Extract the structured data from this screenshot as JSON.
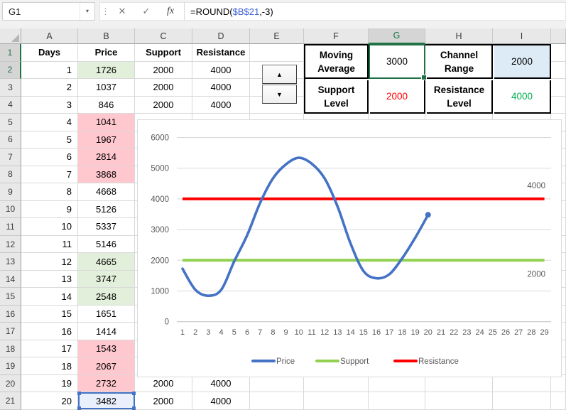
{
  "name_box": {
    "value": "G1"
  },
  "formula_bar": {
    "full": "=ROUND($B$21,-3)",
    "prefix": "=ROUND(",
    "reference": "$B$21",
    "suffix": ",-3)"
  },
  "icons": {
    "cancel": "✕",
    "enter": "✓",
    "function": "fx",
    "namebox_dropdown": "▾",
    "drag_handle": "⋮",
    "spin_up": "▲",
    "spin_down": "▼"
  },
  "colors": {
    "selection_green": "#1E7145",
    "reference_blue": "#4472C4",
    "fill_green": "#E2EFDA",
    "fill_pink": "#FFC7CE",
    "fill_blue": "#DDEBF7",
    "fill_ref": "#E9F0FB",
    "text_red": "#FF0000",
    "text_green": "#00B050"
  },
  "sheet": {
    "column_headers": [
      "A",
      "B",
      "C",
      "D",
      "E",
      "F",
      "G",
      "H",
      "I"
    ],
    "selected_column": "G",
    "selected_cell": "G1",
    "referenced_cell": "B21",
    "selected_row_headers": [
      1,
      2
    ],
    "rows": [
      {
        "r": 1,
        "bold": true,
        "cells": {
          "A": "Days",
          "B": "Price",
          "C": "Support",
          "D": "Resistance"
        }
      },
      {
        "r": 2,
        "cells": {
          "A": "1",
          "B": "1726",
          "C": "2000",
          "D": "4000"
        },
        "fills": {
          "B": "green"
        }
      },
      {
        "r": 3,
        "cells": {
          "A": "2",
          "B": "1037",
          "C": "2000",
          "D": "4000"
        }
      },
      {
        "r": 4,
        "cells": {
          "A": "3",
          "B": "846",
          "C": "2000",
          "D": "4000"
        }
      },
      {
        "r": 5,
        "cells": {
          "A": "4",
          "B": "1041"
        },
        "fills": {
          "B": "pink"
        }
      },
      {
        "r": 6,
        "cells": {
          "A": "5",
          "B": "1967"
        },
        "fills": {
          "B": "pink"
        }
      },
      {
        "r": 7,
        "cells": {
          "A": "6",
          "B": "2814"
        },
        "fills": {
          "B": "pink"
        }
      },
      {
        "r": 8,
        "cells": {
          "A": "7",
          "B": "3868"
        },
        "fills": {
          "B": "pink"
        }
      },
      {
        "r": 9,
        "cells": {
          "A": "8",
          "B": "4668"
        }
      },
      {
        "r": 10,
        "cells": {
          "A": "9",
          "B": "5126"
        }
      },
      {
        "r": 11,
        "cells": {
          "A": "10",
          "B": "5337"
        }
      },
      {
        "r": 12,
        "cells": {
          "A": "11",
          "B": "5146"
        }
      },
      {
        "r": 13,
        "cells": {
          "A": "12",
          "B": "4665"
        },
        "fills": {
          "B": "green"
        }
      },
      {
        "r": 14,
        "cells": {
          "A": "13",
          "B": "3747"
        },
        "fills": {
          "B": "green"
        }
      },
      {
        "r": 15,
        "cells": {
          "A": "14",
          "B": "2548"
        },
        "fills": {
          "B": "green"
        }
      },
      {
        "r": 16,
        "cells": {
          "A": "15",
          "B": "1651"
        }
      },
      {
        "r": 17,
        "cells": {
          "A": "16",
          "B": "1414"
        }
      },
      {
        "r": 18,
        "cells": {
          "A": "17",
          "B": "1543"
        },
        "fills": {
          "B": "pink"
        }
      },
      {
        "r": 19,
        "cells": {
          "A": "18",
          "B": "2067"
        },
        "fills": {
          "B": "pink"
        }
      },
      {
        "r": 20,
        "cells": {
          "A": "19",
          "B": "2732",
          "C": "2000",
          "D": "4000"
        },
        "fills": {
          "B": "pink"
        }
      },
      {
        "r": 21,
        "cells": {
          "A": "20",
          "B": "3482",
          "C": "2000",
          "D": "4000"
        },
        "fills": {
          "B": "ref"
        }
      }
    ]
  },
  "side_table": {
    "rows": [
      [
        {
          "text": "Moving Average",
          "bold": true
        },
        {
          "text": "3000",
          "selected": true
        },
        {
          "text": "Channel Range",
          "bold": true
        },
        {
          "text": "2000",
          "fill": "#DDEBF7"
        }
      ],
      [
        {
          "text": "Support Level",
          "bold": true
        },
        {
          "text": "2000",
          "color": "#FF0000"
        },
        {
          "text": "Resistance Level",
          "bold": true
        },
        {
          "text": "4000",
          "color": "#00B050"
        }
      ]
    ]
  },
  "chart_data": {
    "type": "line",
    "x_categories": [
      1,
      2,
      3,
      4,
      5,
      6,
      7,
      8,
      9,
      10,
      11,
      12,
      13,
      14,
      15,
      16,
      17,
      18,
      19,
      20,
      21,
      22,
      23,
      24,
      25,
      26,
      27,
      28,
      29
    ],
    "series": [
      {
        "name": "Price",
        "color": "#4472C4",
        "smooth": true,
        "marker_last": true,
        "values": [
          1726,
          1037,
          846,
          1041,
          1967,
          2814,
          3868,
          4668,
          5126,
          5337,
          5146,
          4665,
          3747,
          2548,
          1651,
          1414,
          1543,
          2067,
          2732,
          3482
        ]
      },
      {
        "name": "Support",
        "color": "#92D050",
        "constant": 2000,
        "count": 29
      },
      {
        "name": "Resistance",
        "color": "#FF0000",
        "constant": 4000,
        "count": 29
      }
    ],
    "ylim": [
      0,
      6000
    ],
    "yticks": [
      0,
      1000,
      2000,
      3000,
      4000,
      5000,
      6000
    ],
    "grid": true,
    "legend_position": "bottom",
    "legend": [
      {
        "label": "Price",
        "color": "#4472C4"
      },
      {
        "label": "Support",
        "color": "#92D050"
      },
      {
        "label": "Resistance",
        "color": "#FF0000"
      }
    ],
    "data_labels": [
      {
        "text": "4000",
        "series": "Resistance",
        "position": "above-right"
      },
      {
        "text": "2000",
        "series": "Support",
        "position": "below-right"
      }
    ]
  }
}
